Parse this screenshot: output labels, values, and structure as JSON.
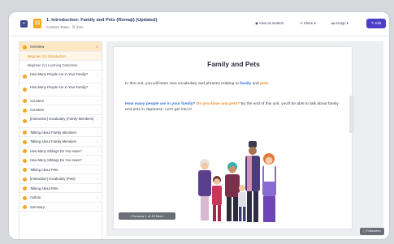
{
  "header": {
    "course_title": "1. Introduction: Family and Pets (Romaji) (Updated)",
    "course_meta": "Content Team · ⏱ 37m",
    "view_as_student": "View as student",
    "share": "Share",
    "assign": "Assign",
    "edit": "Edit"
  },
  "sidebar": {
    "items": [
      {
        "label": "Overview",
        "kind": "head"
      },
      {
        "label": "Beginner (U) Introduction",
        "kind": "sub"
      },
      {
        "label": "Beginner (U) Learning Outcomes",
        "kind": "subplain"
      },
      {
        "label": "How Many People Are in Your Family?",
        "kind": "tall"
      },
      {
        "label": "How Many People Are in Your Family?",
        "kind": "tall"
      },
      {
        "label": "Counters",
        "kind": "item"
      },
      {
        "label": "Counters",
        "kind": "item"
      },
      {
        "label": "[Interactive] Vocabulary (Family Members)",
        "kind": "tall"
      },
      {
        "label": "Talking About Family Members",
        "kind": "item"
      },
      {
        "label": "Talking About Family Members",
        "kind": "item"
      },
      {
        "label": "How Many Siblings Do You Have?",
        "kind": "item"
      },
      {
        "label": "How Many Siblings Do You Have?",
        "kind": "item"
      },
      {
        "label": "Talking About Pets",
        "kind": "item"
      },
      {
        "label": "[Interactive] Vocabulary (Pets)",
        "kind": "item"
      },
      {
        "label": "Talking About Pets",
        "kind": "item"
      },
      {
        "label": "Culture",
        "kind": "item"
      },
      {
        "label": "Summary",
        "kind": "item"
      }
    ]
  },
  "slide": {
    "title": "Family and Pets",
    "p1_a": "In this unit, you will learn new vocabulary and phrases relating to ",
    "p1_family": "family",
    "p1_and": " and ",
    "p1_pets": "pets",
    "p1_end": ".",
    "p2_q1": "How many people are in your family?",
    "p2_q2": " Do you have any pets?",
    "p2_rest": " By the end of this unit, you'll be able to talk about family and pets in Japanese. Let's get into it!"
  },
  "pager": {
    "label": "‹ Previous   1 of 43   Next ›"
  },
  "fullscreen": {
    "label": "⛶ Fullscreen"
  },
  "colors": {
    "accent": "#4b3fc7",
    "orange": "#f2a623",
    "blue": "#2f6fd6"
  }
}
